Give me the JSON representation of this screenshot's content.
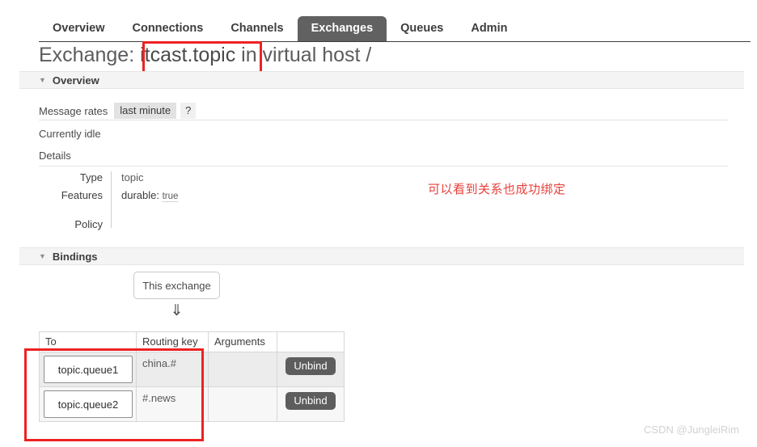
{
  "nav": {
    "tabs": [
      {
        "label": "Overview",
        "active": false
      },
      {
        "label": "Connections",
        "active": false
      },
      {
        "label": "Channels",
        "active": false
      },
      {
        "label": "Exchanges",
        "active": true
      },
      {
        "label": "Queues",
        "active": false
      },
      {
        "label": "Admin",
        "active": false
      }
    ]
  },
  "page": {
    "title_prefix": "Exchange:",
    "exchange_name": "itcast.topic",
    "title_suffix": "in virtual host /"
  },
  "overview": {
    "section_label": "Overview",
    "caret": "▼",
    "message_rates_label": "Message rates",
    "rate_period": "last minute",
    "help": "?",
    "idle_text": "Currently idle",
    "details_label": "Details",
    "details": [
      {
        "key": "Type",
        "value": "topic"
      },
      {
        "key": "Features",
        "value": "durable: true",
        "feature_key": "durable:",
        "feature_value": "true"
      },
      {
        "key": "Policy",
        "value": ""
      }
    ]
  },
  "bindings": {
    "section_label": "Bindings",
    "caret": "▼",
    "this_exchange_label": "This exchange",
    "arrow_glyph": "⇓",
    "columns": [
      "To",
      "Routing key",
      "Arguments",
      ""
    ],
    "rows": [
      {
        "to": "topic.queue1",
        "routing_key": "china.#",
        "arguments": "",
        "action": "Unbind"
      },
      {
        "to": "topic.queue2",
        "routing_key": "#.news",
        "arguments": "",
        "action": "Unbind"
      }
    ]
  },
  "annotations": {
    "note_text": "可以看到关系也成功绑定",
    "note_color": "#e8413c",
    "box_color": "#ee2222"
  },
  "watermark": {
    "text": "CSDN @JungleiRim"
  }
}
